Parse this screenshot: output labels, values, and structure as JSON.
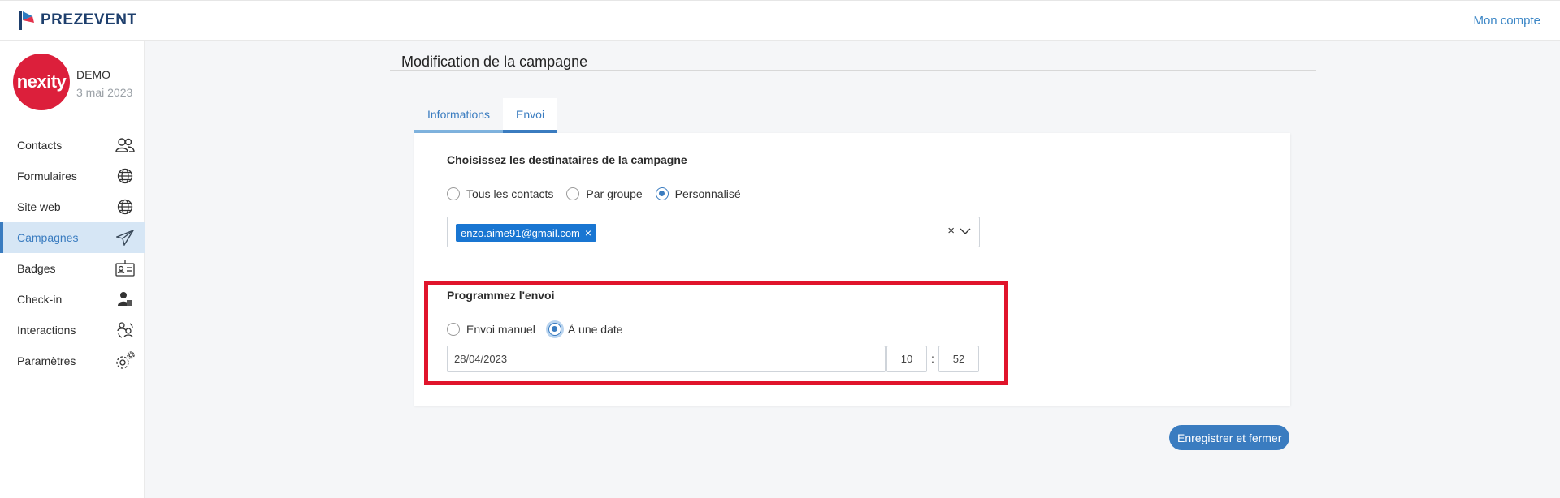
{
  "app": {
    "brand": "PREZEVENT",
    "account_link": "Mon compte"
  },
  "org": {
    "logo_text": "nexity",
    "name": "DEMO",
    "date": "3 mai 2023"
  },
  "sidebar": {
    "items": [
      {
        "label": "Contacts",
        "icon": "contacts-icon"
      },
      {
        "label": "Formulaires",
        "icon": "globe-icon"
      },
      {
        "label": "Site web",
        "icon": "globe-icon"
      },
      {
        "label": "Campagnes",
        "icon": "paper-plane-icon",
        "active": true
      },
      {
        "label": "Badges",
        "icon": "badge-icon"
      },
      {
        "label": "Check-in",
        "icon": "user-check-icon"
      },
      {
        "label": "Interactions",
        "icon": "interactions-icon"
      },
      {
        "label": "Paramètres",
        "icon": "settings-gear-icon"
      }
    ]
  },
  "page": {
    "title": "Modification de la campagne"
  },
  "tabs": [
    {
      "label": "Informations",
      "active": false
    },
    {
      "label": "Envoi",
      "active": true
    }
  ],
  "recipients": {
    "title": "Choisissez les destinataires de la campagne",
    "options": [
      "Tous les contacts",
      "Par groupe",
      "Personnalisé"
    ],
    "selected": "Personnalisé",
    "chips": [
      "enzo.aime91@gmail.com"
    ],
    "chip_remove": "×",
    "clear": "×"
  },
  "schedule": {
    "title": "Programmez l'envoi",
    "options": [
      "Envoi manuel",
      "À une date"
    ],
    "selected": "À une date",
    "date": "28/04/2023",
    "hour": "10",
    "separator": ":",
    "minute": "52"
  },
  "actions": {
    "save_label": "Enregistrer et fermer"
  },
  "colors": {
    "accent": "#3a7cc0",
    "chip": "#1976d2",
    "highlight": "#e0142b",
    "brand_red": "#dc1f3b"
  }
}
